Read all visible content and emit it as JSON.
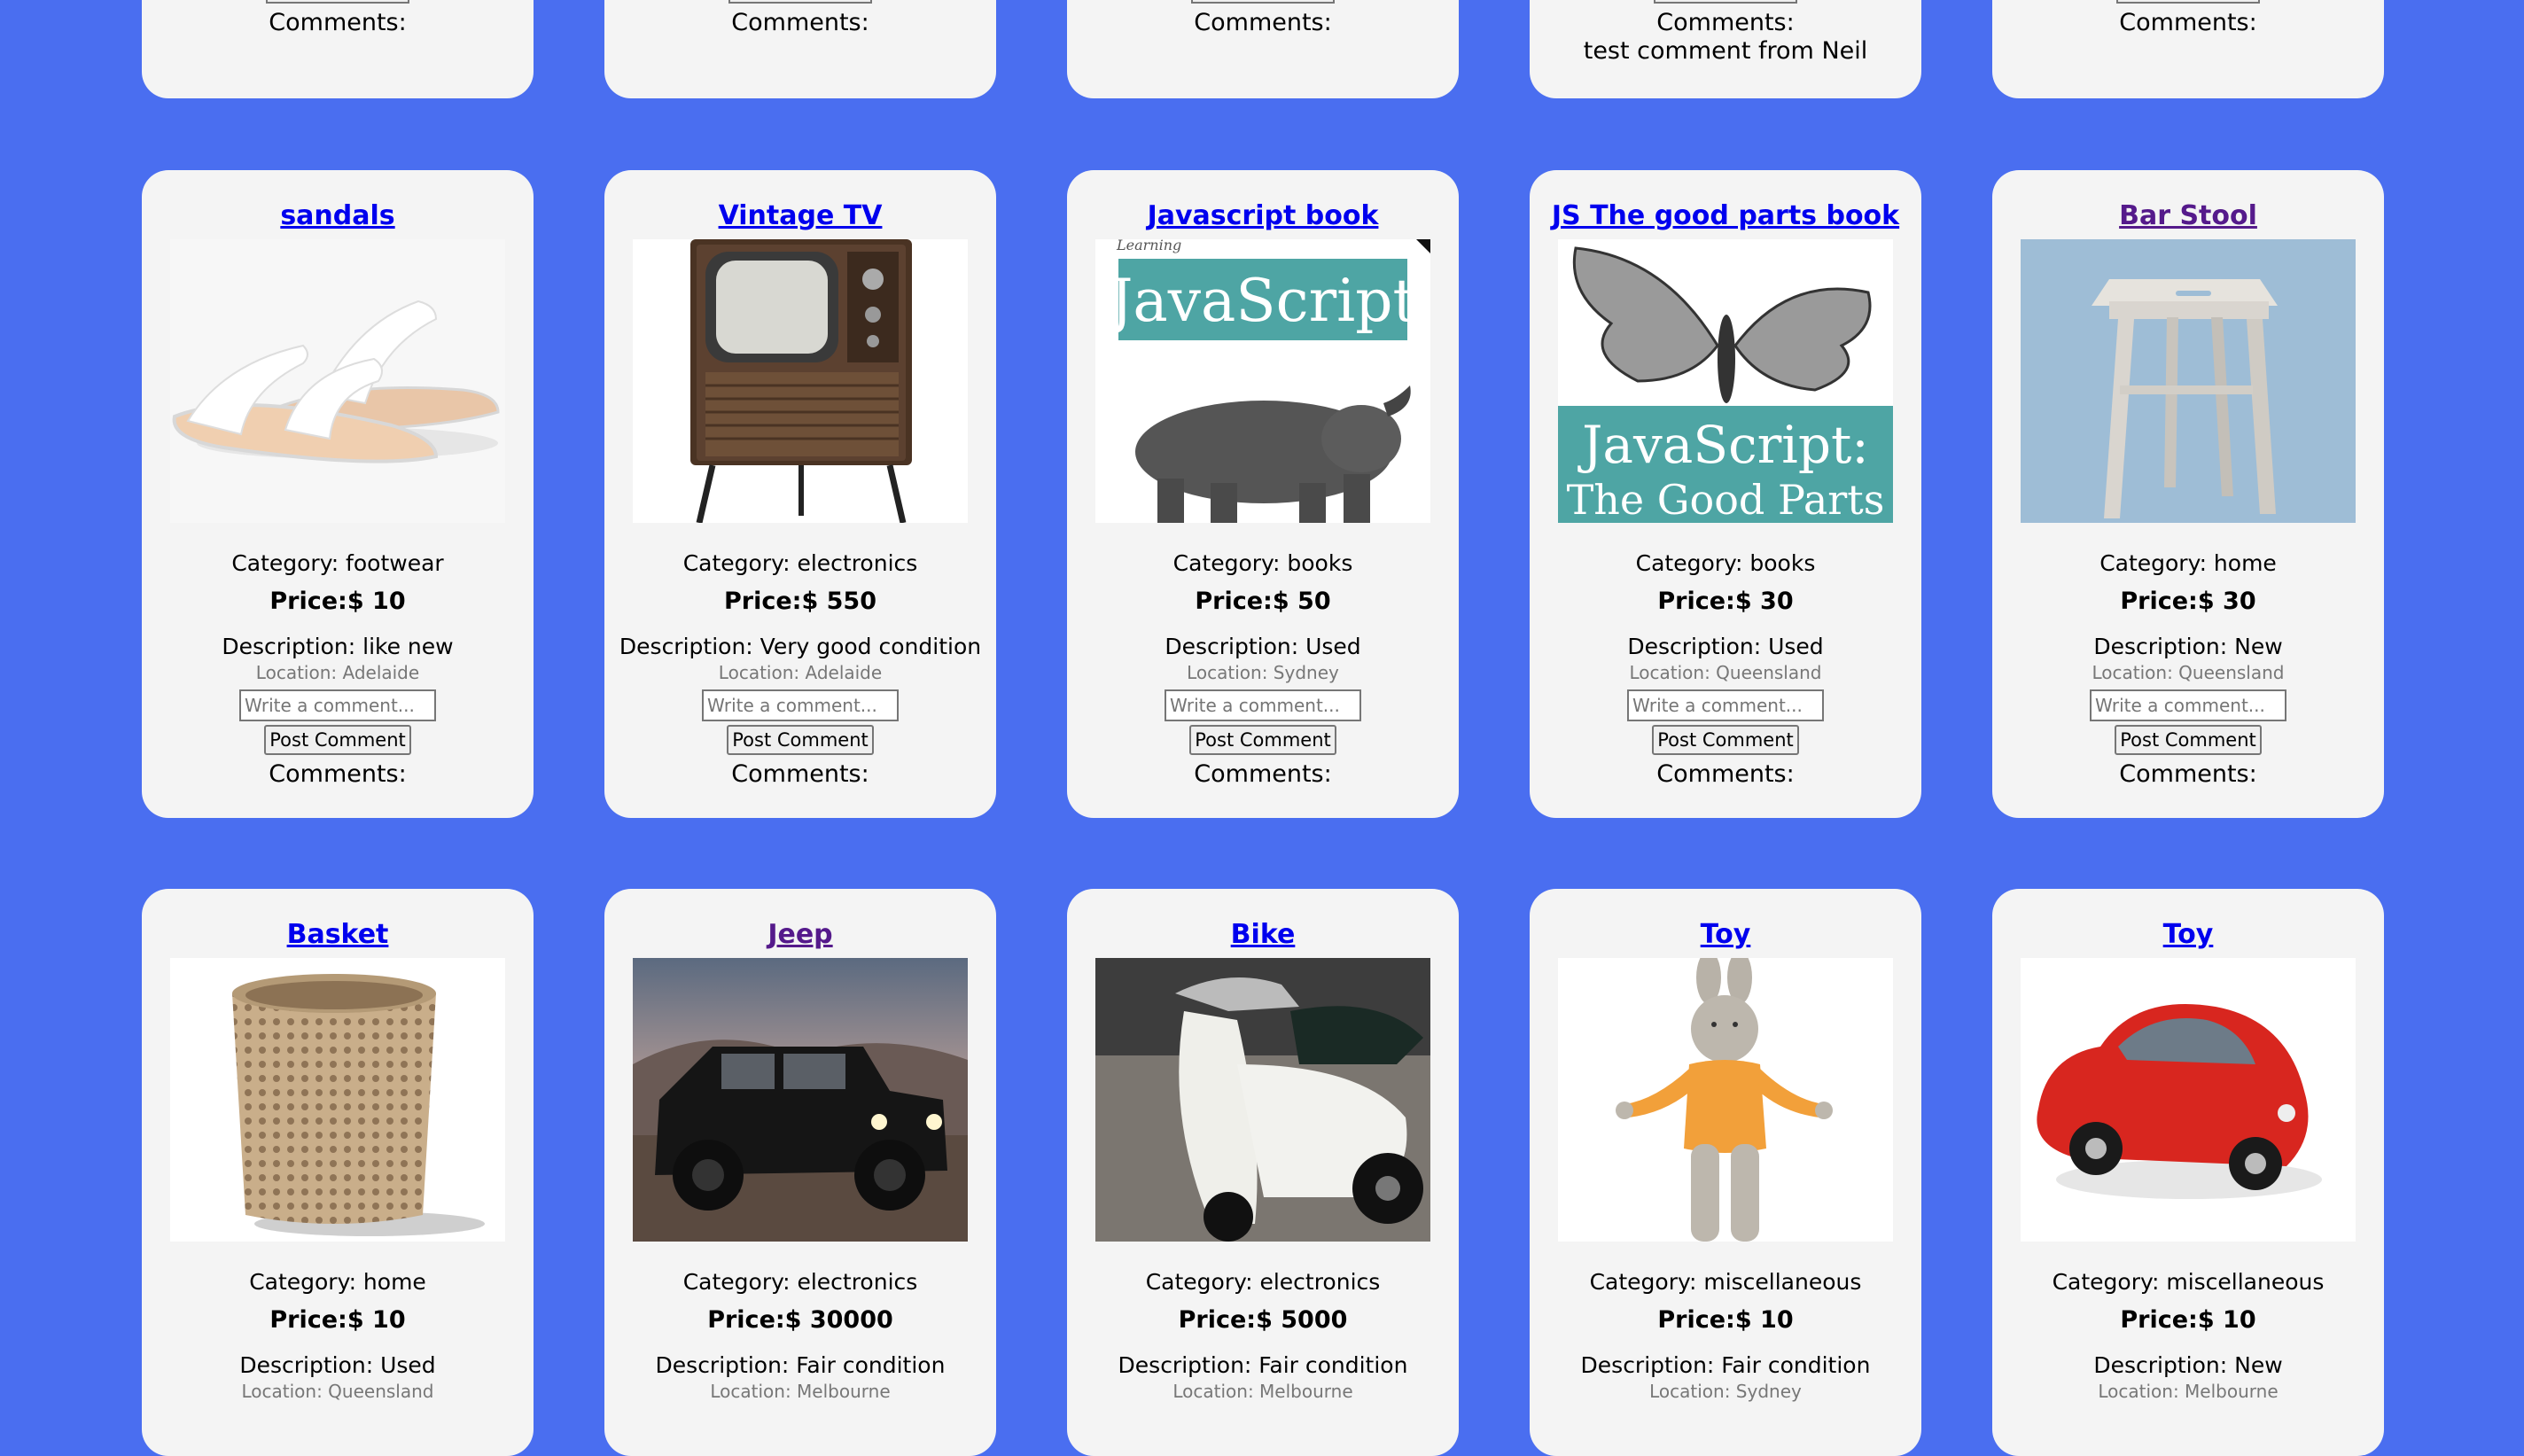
{
  "common": {
    "comment_placeholder": "Write a comment...",
    "post_label": "Post Comment",
    "comments_label": "Comments:"
  },
  "top_cards": [
    {
      "comment": ""
    },
    {
      "comment": ""
    },
    {
      "comment": ""
    },
    {
      "comment": "test comment from Neil"
    },
    {
      "comment": ""
    }
  ],
  "cards": [
    {
      "title": "sandals",
      "category": "Category: footwear",
      "price": "Price:$ 10",
      "description": "Description: like new",
      "location": "Location: Adelaide",
      "image": "sandals-image"
    },
    {
      "title": "Vintage TV",
      "category": "Category: electronics",
      "price": "Price:$ 550",
      "description": "Description: Very good condition",
      "location": "Location: Adelaide",
      "image": "tv-image"
    },
    {
      "title": "Javascript book",
      "category": "Category: books",
      "price": "Price:$ 50",
      "description": "Description: Used",
      "location": "Location: Sydney",
      "image": "js-book-image",
      "cover_small": "Learning",
      "cover_big": "JavaScript"
    },
    {
      "title": "JS The good parts book",
      "category": "Category: books",
      "price": "Price:$ 30",
      "description": "Description: Used",
      "location": "Location: Queensland",
      "image": "good-parts-image",
      "cover_line1": "JavaScript:",
      "cover_line2": "The Good Parts"
    },
    {
      "title": "Bar Stool",
      "category": "Category: home",
      "price": "Price:$ 30",
      "description": "Description: New",
      "location": "Location: Queensland",
      "image": "stool-image"
    },
    {
      "title": "Basket",
      "category": "Category: home",
      "price": "Price:$ 10",
      "description": "Description: Used",
      "location": "Location: Queensland",
      "image": "basket-image"
    },
    {
      "title": "Jeep",
      "category": "Category: electronics",
      "price": "Price:$ 30000",
      "description": "Description: Fair condition",
      "location": "Location: Melbourne",
      "image": "jeep-image"
    },
    {
      "title": "Bike",
      "category": "Category: electronics",
      "price": "Price:$ 5000",
      "description": "Description: Fair condition",
      "location": "Location: Melbourne",
      "image": "scooter-image"
    },
    {
      "title": "Toy",
      "category": "Category: miscellaneous",
      "price": "Price:$ 10",
      "description": "Description: Fair condition",
      "location": "Location: Sydney",
      "image": "bunny-toy-image"
    },
    {
      "title": "Toy",
      "category": "Category: miscellaneous",
      "price": "Price:$ 10",
      "description": "Description: New",
      "location": "Location: Melbourne",
      "image": "toy-car-image"
    }
  ]
}
